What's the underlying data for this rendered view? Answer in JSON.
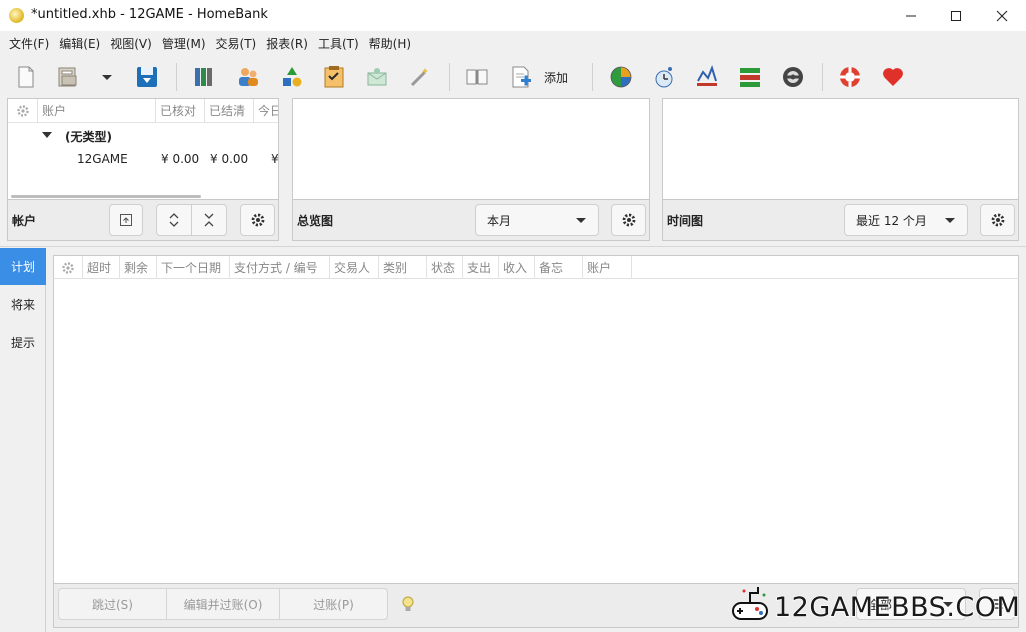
{
  "window": {
    "title": "*untitled.xhb - 12GAME - HomeBank",
    "minimize": "—",
    "maximize": "☐",
    "close": "✕"
  },
  "menu": [
    "文件(F)",
    "编辑(E)",
    "视图(V)",
    "管理(M)",
    "交易(T)",
    "报表(R)",
    "工具(T)",
    "帮助(H)"
  ],
  "toolbar": {
    "add_label": "添加",
    "icons": [
      "new-file-icon",
      "open-folder-icon",
      "recent-dropdown-icon",
      "save-icon",
      "accounts-icon",
      "payees-icon",
      "categories-icon",
      "scheduled-icon",
      "budget-icon",
      "assignments-icon",
      "show-register-icon",
      "add-transaction-icon",
      "statistics-icon",
      "trend-icon",
      "balance-icon",
      "budget-report-icon",
      "vehicle-cost-icon",
      "help-icon",
      "donate-icon"
    ]
  },
  "accounts_panel": {
    "columns": [
      "账户",
      "已核对",
      "已结清",
      "今日"
    ],
    "group_label": "(无类型)",
    "rows": [
      {
        "name": "12GAME",
        "reconciled": "¥ 0.00",
        "cleared": "¥ 0.00",
        "today": "¥"
      }
    ],
    "footer_label": "帐户"
  },
  "summary_panel": {
    "footer_label": "总览图",
    "range": "本月"
  },
  "timechart_panel": {
    "footer_label": "时间图",
    "range": "最近 12 个月"
  },
  "sidebar": {
    "tabs": [
      {
        "label": "计划",
        "active": true
      },
      {
        "label": "将来",
        "active": false
      },
      {
        "label": "提示",
        "active": false
      }
    ]
  },
  "schedule": {
    "columns": [
      "超时",
      "剩余",
      "下一个日期",
      "支付方式 / 编号",
      "交易人",
      "类别",
      "状态",
      "支出",
      "收入",
      "备忘",
      "账户"
    ],
    "actions": {
      "skip": "跳过(S)",
      "edit_post": "编辑并过账(O)",
      "post": "过账(P)"
    },
    "filter": "全部"
  },
  "watermark": {
    "text": "12GAMEBBS.COM"
  },
  "colors": {
    "accent": "#3a8ee6",
    "panel_bg": "#ffffff",
    "chrome_bg": "#f0f0f0"
  }
}
